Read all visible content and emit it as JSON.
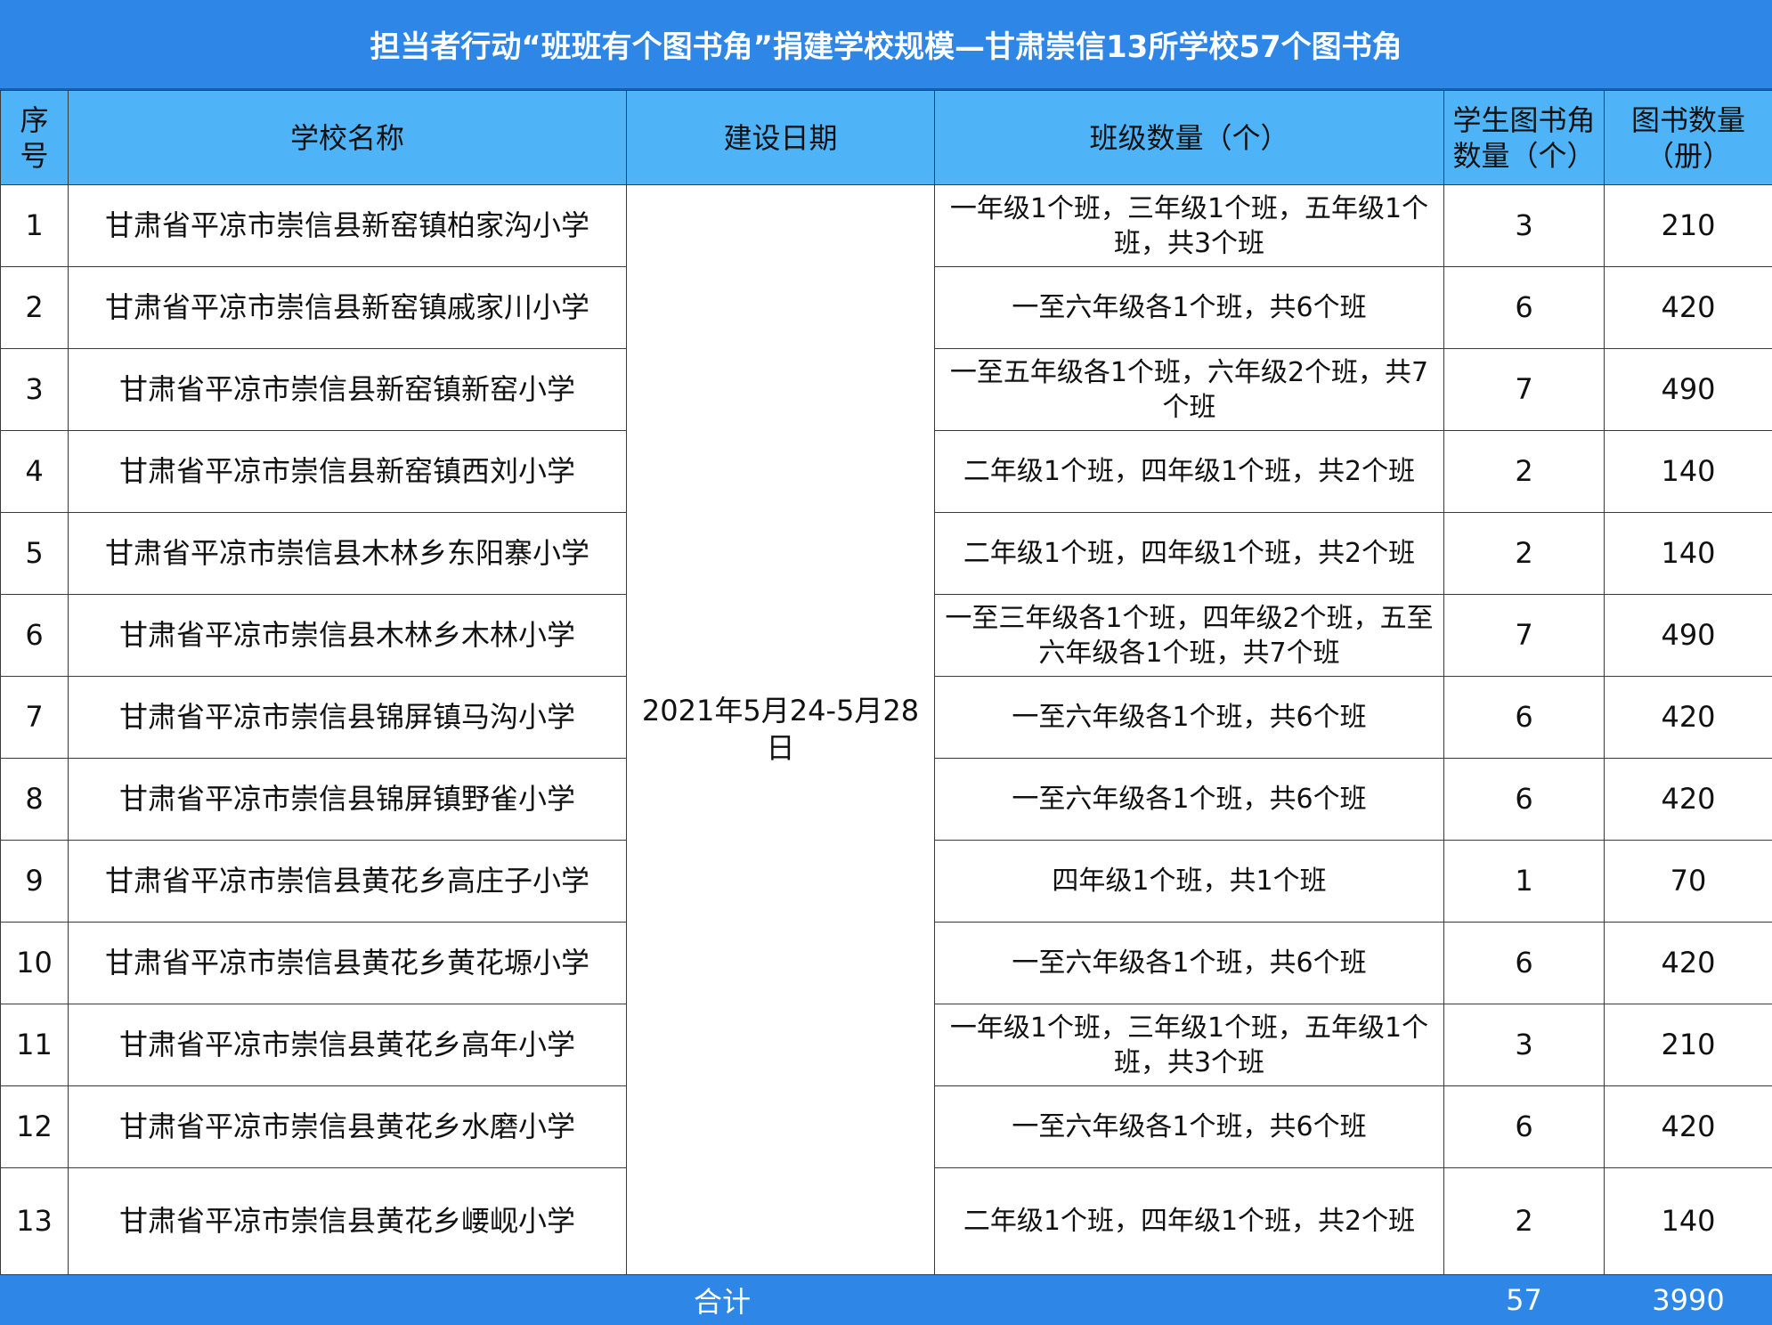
{
  "title": "担当者行动“班班有个图书角”捐建学校规模—甘肃崇信13所学校57个图书角",
  "headers": {
    "no": "序号",
    "school": "学校名称",
    "date": "建设日期",
    "classes": "班级数量（个）",
    "corners": "学生图书角数量（个）",
    "books": "图书数量（册）"
  },
  "build_date": "2021年5月24-5月28日",
  "rows": [
    {
      "no": "1",
      "school": "甘肃省平凉市崇信县新窑镇柏家沟小学",
      "classes": "一年级1个班，三年级1个班，五年级1个班，共3个班",
      "corners": "3",
      "books": "210"
    },
    {
      "no": "2",
      "school": "甘肃省平凉市崇信县新窑镇戚家川小学",
      "classes": "一至六年级各1个班，共6个班",
      "corners": "6",
      "books": "420"
    },
    {
      "no": "3",
      "school": "甘肃省平凉市崇信县新窑镇新窑小学",
      "classes": "一至五年级各1个班，六年级2个班，共7个班",
      "corners": "7",
      "books": "490"
    },
    {
      "no": "4",
      "school": "甘肃省平凉市崇信县新窑镇西刘小学",
      "classes": "二年级1个班，四年级1个班，共2个班",
      "corners": "2",
      "books": "140"
    },
    {
      "no": "5",
      "school": "甘肃省平凉市崇信县木林乡东阳寨小学",
      "classes": "二年级1个班，四年级1个班，共2个班",
      "corners": "2",
      "books": "140"
    },
    {
      "no": "6",
      "school": "甘肃省平凉市崇信县木林乡木林小学",
      "classes": "一至三年级各1个班，四年级2个班，五至六年级各1个班，共7个班",
      "corners": "7",
      "books": "490"
    },
    {
      "no": "7",
      "school": "甘肃省平凉市崇信县锦屏镇马沟小学",
      "classes": "一至六年级各1个班，共6个班",
      "corners": "6",
      "books": "420"
    },
    {
      "no": "8",
      "school": "甘肃省平凉市崇信县锦屏镇野雀小学",
      "classes": "一至六年级各1个班，共6个班",
      "corners": "6",
      "books": "420"
    },
    {
      "no": "9",
      "school": "甘肃省平凉市崇信县黄花乡高庄子小学",
      "classes": "四年级1个班，共1个班",
      "corners": "1",
      "books": "70"
    },
    {
      "no": "10",
      "school": "甘肃省平凉市崇信县黄花乡黄花塬小学",
      "classes": "一至六年级各1个班，共6个班",
      "corners": "6",
      "books": "420"
    },
    {
      "no": "11",
      "school": "甘肃省平凉市崇信县黄花乡高年小学",
      "classes": "一年级1个班，三年级1个班，五年级1个班，共3个班",
      "corners": "3",
      "books": "210"
    },
    {
      "no": "12",
      "school": "甘肃省平凉市崇信县黄花乡水磨小学",
      "classes": "一至六年级各1个班，共6个班",
      "corners": "6",
      "books": "420"
    },
    {
      "no": "13",
      "school": "甘肃省平凉市崇信县黄花乡崾岘小学",
      "classes": "二年级1个班，四年级1个班，共2个班",
      "corners": "2",
      "books": "140"
    }
  ],
  "total": {
    "label": "合计",
    "corners": "57",
    "books": "3990"
  }
}
